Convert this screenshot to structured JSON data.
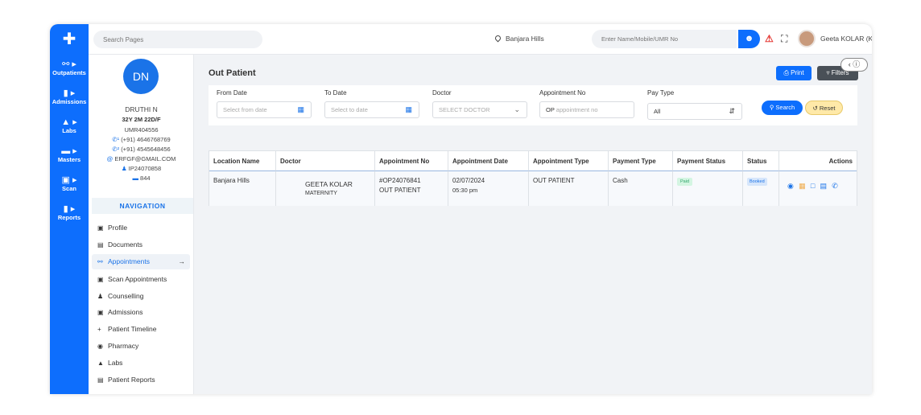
{
  "colors": {
    "primary": "#0d6efd",
    "filters_button": "#495057",
    "reset_button": "#ffe9a8",
    "paid_badge": "#2fa66a",
    "booked_badge": "#1a73e8"
  },
  "rail": {
    "logo_icon": "medical-cross-logo",
    "items": [
      {
        "label": "Outpatients",
        "icon": "stethoscope-icon"
      },
      {
        "label": "Admissions",
        "icon": "document-icon"
      },
      {
        "label": "Labs",
        "icon": "flask-icon"
      },
      {
        "label": "Masters",
        "icon": "monitor-icon"
      },
      {
        "label": "Scan",
        "icon": "scan-icon"
      },
      {
        "label": "Reports",
        "icon": "report-icon"
      }
    ]
  },
  "topbar": {
    "search_placeholder": "Search Pages",
    "location": "Banjara Hills",
    "patient_search_placeholder": "Enter Name/Mobile/UMR No",
    "user_name": "Geeta KOLAR (KOLAR)"
  },
  "patient": {
    "initials": "DN",
    "name": "DRUTHI N",
    "age_gender": "32Y 2M 22D/F",
    "umr": "UMR404556",
    "phone1": "(+91) 4646768769",
    "phone2": "(+91) 4545648456",
    "email": "ERFGF@GMAIL.COM",
    "ip": "IP24070858",
    "bed": "844"
  },
  "navigation": {
    "heading": "NAVIGATION",
    "items": [
      {
        "label": "Profile",
        "icon": "id-card-icon"
      },
      {
        "label": "Documents",
        "icon": "documents-icon"
      },
      {
        "label": "Appointments",
        "icon": "stethoscope-icon"
      },
      {
        "label": "Scan Appointments",
        "icon": "scan-icon"
      },
      {
        "label": "Counselling",
        "icon": "people-icon"
      },
      {
        "label": "Admissions",
        "icon": "bed-card-icon"
      },
      {
        "label": "Patient Timeline",
        "icon": "plus-icon"
      },
      {
        "label": "Pharmacy",
        "icon": "pill-icon"
      },
      {
        "label": "Labs",
        "icon": "flask-icon"
      },
      {
        "label": "Patient Reports",
        "icon": "report-icon"
      }
    ]
  },
  "main": {
    "title": "Out Patient",
    "print_label": "Print",
    "filters_label": "Filters",
    "filters": {
      "from_date_label": "From Date",
      "from_date_placeholder": "Select from date",
      "to_date_label": "To Date",
      "to_date_placeholder": "Select to date",
      "doctor_label": "Doctor",
      "doctor_placeholder": "SELECT DOCTOR",
      "appointment_no_label": "Appointment No",
      "appointment_no_prefix": "OP",
      "appointment_no_placeholder": "appointment no",
      "pay_type_label": "Pay Type",
      "pay_type_value": "All",
      "search_label": "Search",
      "reset_label": "Reset"
    },
    "table": {
      "headers": [
        "Location Name",
        "Doctor",
        "Appointment No",
        "Appointment Date",
        "Appointment Type",
        "Payment Type",
        "Payment Status",
        "Status",
        "Actions"
      ],
      "rows": [
        {
          "location": "Banjara Hills",
          "doctor_name": "GEETA KOLAR",
          "doctor_dept": "MATERNITY",
          "appointment_no": "#OP24076841",
          "appointment_kind": "OUT PATIENT",
          "date": "02/07/2024",
          "time": "05:30 pm",
          "type": "OUT PATIENT",
          "payment_type": "Cash",
          "payment_status": "Paid",
          "status": "Booked"
        }
      ]
    }
  }
}
